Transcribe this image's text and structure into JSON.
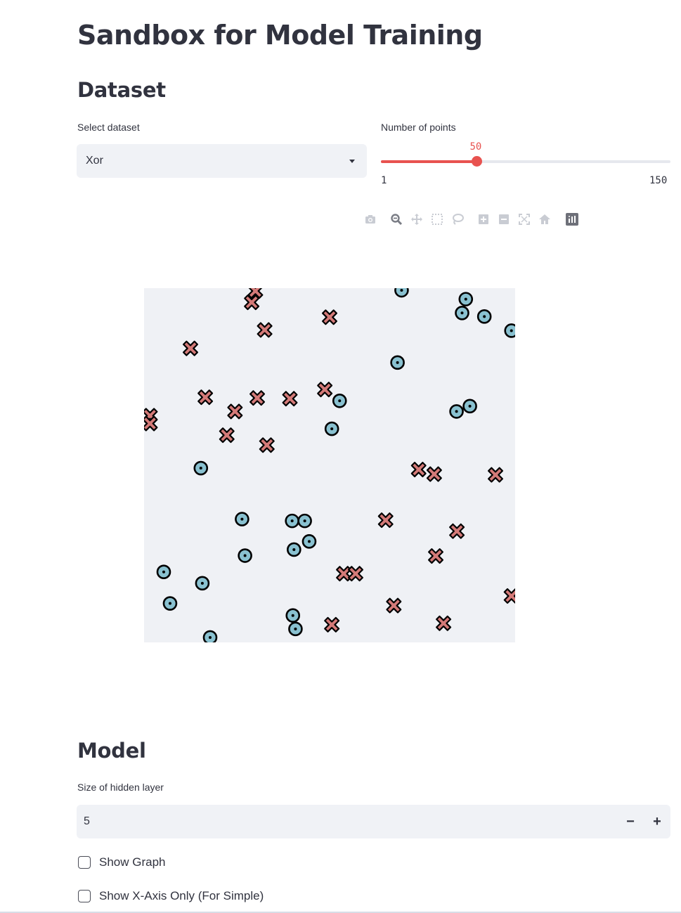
{
  "page": {
    "title": "Sandbox for Model Training"
  },
  "dataset": {
    "heading": "Dataset",
    "select_label": "Select dataset",
    "select_value": "Xor",
    "points_label": "Number of points",
    "points_value": "50",
    "points_min": "1",
    "points_max": "150",
    "points_fraction": 0.3289
  },
  "modebar": {
    "icons": [
      "camera-icon",
      "zoom-icon",
      "pan-icon",
      "box-select-icon",
      "lasso-select-icon",
      "zoom-in-icon",
      "zoom-out-icon",
      "autoscale-icon",
      "reset-axes-icon",
      "plotly-logo-icon"
    ]
  },
  "colors": {
    "accent": "#e8524f",
    "class_x": "#d47a78",
    "class_o": "#89c1d0",
    "plot_bg": "#eff1f5"
  },
  "chart_data": {
    "type": "scatter",
    "title": "",
    "xlabel": "",
    "ylabel": "",
    "xlim": [
      0,
      1
    ],
    "ylim": [
      0,
      1
    ],
    "grid": false,
    "legend": "none",
    "series": [
      {
        "marker": "x",
        "x": [
          0.3,
          0.29,
          0.325,
          0.5,
          0.125,
          0.165,
          0.305,
          0.393,
          0.487,
          0.245,
          0.016,
          0.016,
          0.223,
          0.331,
          0.74,
          0.782,
          0.947,
          0.651,
          0.843,
          0.786,
          0.538,
          0.57,
          0.673,
          0.807,
          0.506,
          0.99
        ],
        "y": [
          0.992,
          0.96,
          0.882,
          0.918,
          0.83,
          0.692,
          0.69,
          0.688,
          0.714,
          0.652,
          0.64,
          0.618,
          0.585,
          0.557,
          0.488,
          0.475,
          0.473,
          0.345,
          0.314,
          0.244,
          0.194,
          0.194,
          0.104,
          0.054,
          0.05,
          0.131
        ]
      },
      {
        "marker": "o",
        "x": [
          0.694,
          0.867,
          0.857,
          0.917,
          0.99,
          0.683,
          0.527,
          0.878,
          0.842,
          0.506,
          0.153,
          0.264,
          0.399,
          0.433,
          0.445,
          0.272,
          0.404,
          0.053,
          0.157,
          0.07,
          0.401,
          0.408,
          0.178
        ],
        "y": [
          0.994,
          0.969,
          0.93,
          0.92,
          0.88,
          0.79,
          0.682,
          0.667,
          0.652,
          0.603,
          0.492,
          0.348,
          0.343,
          0.343,
          0.285,
          0.245,
          0.262,
          0.199,
          0.167,
          0.11,
          0.076,
          0.038,
          0.014
        ]
      }
    ]
  },
  "model": {
    "heading": "Model",
    "hidden_label": "Size of hidden layer",
    "hidden_value": "5",
    "minus_label": "−",
    "plus_label": "+",
    "show_graph_label": "Show Graph",
    "show_x_axis_label": "Show X-Axis Only (For Simple)"
  }
}
